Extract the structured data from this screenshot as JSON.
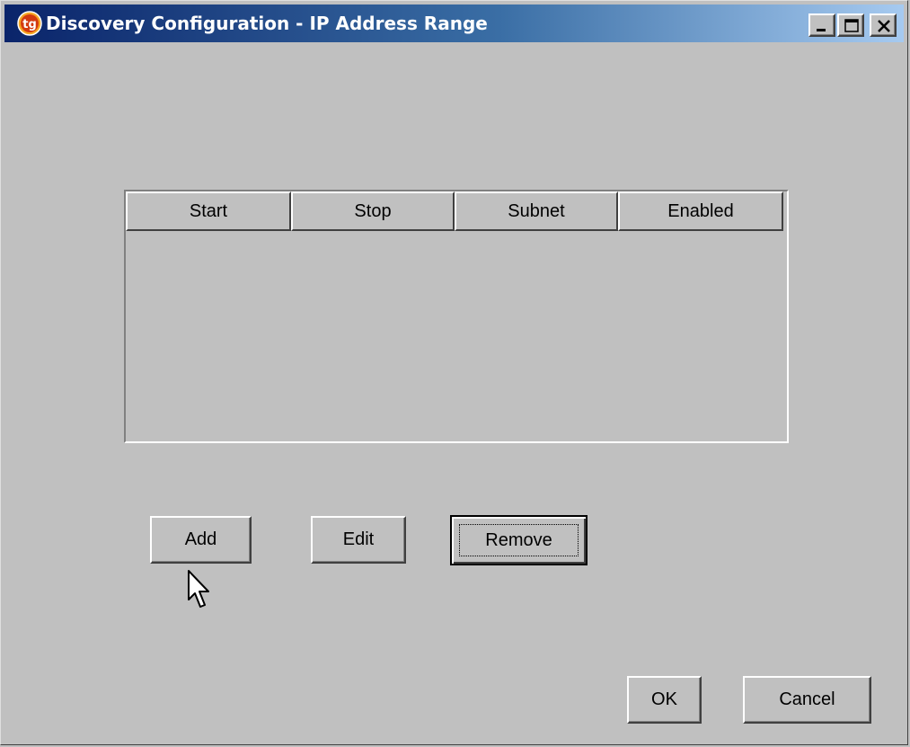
{
  "window": {
    "title": "Discovery Configuration - IP Address Range",
    "app_icon": "tg-logo-icon",
    "controls": [
      "minimize-icon",
      "maximize-icon",
      "close-icon"
    ]
  },
  "table": {
    "columns": [
      "Start",
      "Stop",
      "Subnet",
      "Enabled"
    ],
    "rows": []
  },
  "buttons": {
    "add": "Add",
    "edit": "Edit",
    "remove": "Remove",
    "ok": "OK",
    "cancel": "Cancel"
  },
  "colors": {
    "title_bar_start": "#0a246a",
    "title_bar_end": "#a6caf0",
    "window_face": "#c0c0c0"
  }
}
